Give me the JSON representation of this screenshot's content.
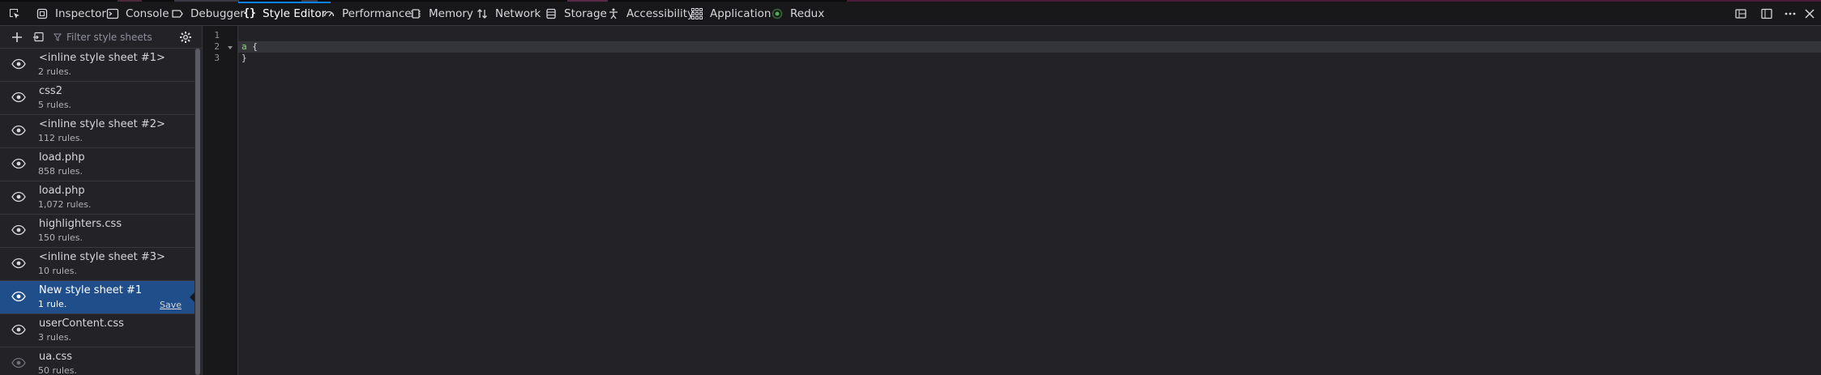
{
  "toolbar": {
    "tabs": [
      {
        "label": "Inspector",
        "icon": "inspector-icon"
      },
      {
        "label": "Console",
        "icon": "console-icon"
      },
      {
        "label": "Debugger",
        "icon": "debugger-icon"
      },
      {
        "label": "Style Editor",
        "icon": "style-editor-icon",
        "active": true
      },
      {
        "label": "Performance",
        "icon": "performance-icon"
      },
      {
        "label": "Memory",
        "icon": "memory-icon"
      },
      {
        "label": "Network",
        "icon": "network-icon"
      },
      {
        "label": "Storage",
        "icon": "storage-icon"
      },
      {
        "label": "Accessibility",
        "icon": "accessibility-icon"
      },
      {
        "label": "Application",
        "icon": "application-icon"
      },
      {
        "label": "Redux",
        "icon": "redux-icon"
      }
    ],
    "right_icons": [
      "dock-options-icon",
      "split-console-icon",
      "more-options-icon",
      "close-icon"
    ]
  },
  "sidebar": {
    "filter_placeholder": "Filter style sheets",
    "items": [
      {
        "name": "<inline style sheet #1>",
        "rules": "2 rules."
      },
      {
        "name": "css2",
        "rules": "5 rules."
      },
      {
        "name": "<inline style sheet #2>",
        "rules": "112 rules."
      },
      {
        "name": "load.php",
        "rules": "858 rules."
      },
      {
        "name": "load.php",
        "rules": "1,072 rules."
      },
      {
        "name": "highlighters.css",
        "rules": "150 rules."
      },
      {
        "name": "<inline style sheet #3>",
        "rules": "10 rules."
      },
      {
        "name": "New style sheet #1",
        "rules": "1 rule.",
        "selected": true,
        "save": "Save"
      },
      {
        "name": "userContent.css",
        "rules": "3 rules."
      },
      {
        "name": "ua.css",
        "rules": "50 rules."
      }
    ]
  },
  "editor": {
    "line_numbers": [
      "1",
      "2",
      "3"
    ],
    "lines": [
      "",
      "a {",
      "}"
    ],
    "active_line": 2
  },
  "colors": {
    "accent": "#0a84ff",
    "selected_bg": "#204e8a"
  }
}
